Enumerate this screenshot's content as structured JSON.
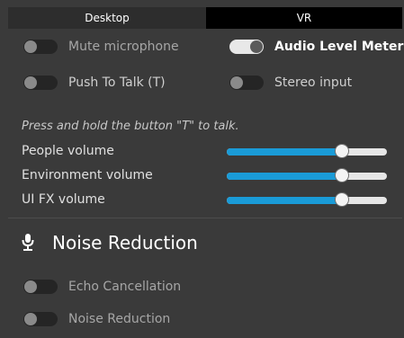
{
  "tabs": [
    {
      "label": "Desktop",
      "active": true
    },
    {
      "label": "VR",
      "active": false
    }
  ],
  "toggles": {
    "mute_microphone": {
      "label": "Mute microphone",
      "on": false
    },
    "push_to_talk": {
      "label": "Push To Talk (T)",
      "on": false
    },
    "audio_level_meter": {
      "label": "Audio Level Meter",
      "on": true
    },
    "stereo_input": {
      "label": "Stereo input",
      "on": false
    }
  },
  "hint": "Press and hold the button \"T\" to talk.",
  "volumes": [
    {
      "label": "People volume",
      "value": 0.72
    },
    {
      "label": "Environment volume",
      "value": 0.72
    },
    {
      "label": "UI FX volume",
      "value": 0.72
    }
  ],
  "noise_section": {
    "title": "Noise Reduction",
    "icon": "microphone-icon",
    "toggles": [
      {
        "label": "Echo Cancellation",
        "on": false
      },
      {
        "label": "Noise Reduction",
        "on": false
      }
    ]
  },
  "colors": {
    "accent": "#1a9bd7",
    "background": "#3a3a3a",
    "tab_active": "#2d2d2d",
    "tab_inactive": "#000000"
  }
}
